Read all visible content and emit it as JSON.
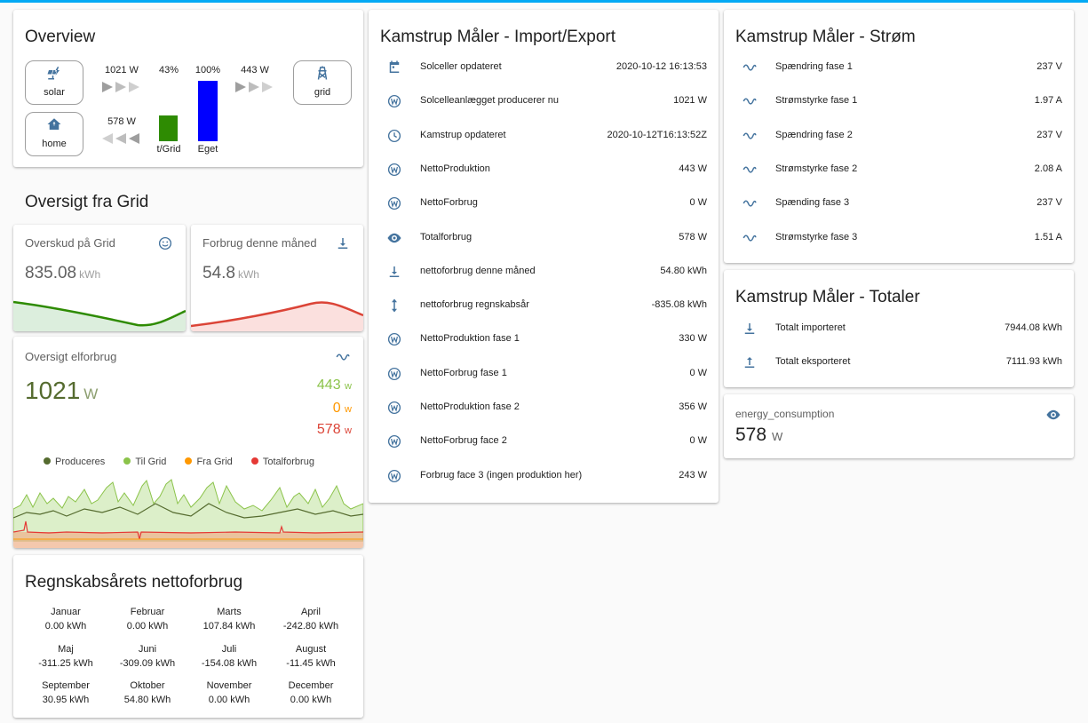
{
  "colors": {
    "accent": "#03a9f4",
    "icon": "#44739e",
    "green": "#2e8b02",
    "blue": "#0000ff",
    "red_line": "#db4437",
    "light_green": "#8bc34a",
    "orange": "#ff9800"
  },
  "overview": {
    "title": "Overview",
    "solar_label": "solar",
    "grid_label": "grid",
    "home_label": "home",
    "solar_to_home": "1021 W",
    "solar_pct": "43%",
    "self_pct": "100%",
    "grid_export": "443 W",
    "home_consumption": "578 W",
    "bar_grid_label": "t/Grid",
    "bar_self_label": "Eget"
  },
  "grid_section": {
    "title": "Oversigt fra Grid"
  },
  "surplus": {
    "name": "Overskud på Grid",
    "value": "835.08",
    "unit": "kWh",
    "icon": "smile-icon"
  },
  "month_use": {
    "name": "Forbrug denne måned",
    "value": "54.8",
    "unit": "kWh",
    "icon": "download-icon"
  },
  "elforbrug": {
    "name": "Oversigt elforbrug",
    "value": "1021",
    "unit": "W",
    "sub_values": [
      {
        "value": "443",
        "unit": "w",
        "color": "#8bc34a"
      },
      {
        "value": "0",
        "unit": "w",
        "color": "#ff9800"
      },
      {
        "value": "578",
        "unit": "w",
        "color": "#db4437"
      }
    ],
    "legend": [
      {
        "label": "Produceres",
        "color": "#556b2f"
      },
      {
        "label": "Til Grid",
        "color": "#8bc34a"
      },
      {
        "label": "Fra Grid",
        "color": "#ff9800"
      },
      {
        "label": "Totalforbrug",
        "color": "#e53935"
      }
    ]
  },
  "netto_year": {
    "title": "Regnskabsårets nettoforbrug",
    "months": [
      {
        "name": "Januar",
        "value": "0.00 kWh"
      },
      {
        "name": "Februar",
        "value": "0.00 kWh"
      },
      {
        "name": "Marts",
        "value": "107.84 kWh"
      },
      {
        "name": "April",
        "value": "-242.80 kWh"
      },
      {
        "name": "Maj",
        "value": "-311.25 kWh"
      },
      {
        "name": "Juni",
        "value": "-309.09 kWh"
      },
      {
        "name": "Juli",
        "value": "-154.08 kWh"
      },
      {
        "name": "August",
        "value": "-11.45 kWh"
      },
      {
        "name": "September",
        "value": "30.95 kWh"
      },
      {
        "name": "Oktober",
        "value": "54.80 kWh"
      },
      {
        "name": "November",
        "value": "0.00 kWh"
      },
      {
        "name": "December",
        "value": "0.00 kWh"
      }
    ]
  },
  "import_export": {
    "title": "Kamstrup Måler - Import/Export",
    "rows": [
      {
        "icon": "calendar-icon",
        "name": "Solceller opdateret",
        "value": "2020-10-12 16:13:53"
      },
      {
        "icon": "w-icon",
        "name": "Solcelleanlægget producerer nu",
        "value": "1021 W"
      },
      {
        "icon": "clock-icon",
        "name": "Kamstrup opdateret",
        "value": "2020-10-12T16:13:52Z"
      },
      {
        "icon": "w-icon",
        "name": "NettoProduktion",
        "value": "443 W"
      },
      {
        "icon": "w-icon",
        "name": "NettoForbrug",
        "value": "0 W"
      },
      {
        "icon": "eye-icon",
        "name": "Totalforbrug",
        "value": "578 W"
      },
      {
        "icon": "download-icon",
        "name": "nettoforbrug denne måned",
        "value": "54.80 kWh"
      },
      {
        "icon": "updown-icon",
        "name": "nettoforbrug regnskabsår",
        "value": "-835.08 kWh"
      },
      {
        "icon": "w-icon",
        "name": "NettoProduktion fase 1",
        "value": "330 W"
      },
      {
        "icon": "w-icon",
        "name": "NettoForbrug fase 1",
        "value": "0 W"
      },
      {
        "icon": "w-icon",
        "name": "NettoProduktion fase 2",
        "value": "356 W"
      },
      {
        "icon": "w-icon",
        "name": "NettoForbrug face 2",
        "value": "0 W"
      },
      {
        "icon": "w-icon",
        "name": "Forbrug face 3 (ingen produktion her)",
        "value": "243 W"
      }
    ]
  },
  "strom": {
    "title": "Kamstrup Måler - Strøm",
    "rows": [
      {
        "icon": "sine-icon",
        "name": "Spændring fase 1",
        "value": "237 V"
      },
      {
        "icon": "sine-icon",
        "name": "Strømstyrke fase 1",
        "value": "1.97 A"
      },
      {
        "icon": "sine-icon",
        "name": "Spændring fase 2",
        "value": "237 V"
      },
      {
        "icon": "sine-icon",
        "name": "Strømstyrke fase 2",
        "value": "2.08 A"
      },
      {
        "icon": "sine-icon",
        "name": "Spænding fase 3",
        "value": "237 V"
      },
      {
        "icon": "sine-icon",
        "name": "Strømstyrke fase 3",
        "value": "1.51 A"
      }
    ]
  },
  "totaler": {
    "title": "Kamstrup Måler - Totaler",
    "rows": [
      {
        "icon": "download-icon",
        "name": "Totalt importeret",
        "value": "7944.08 kWh"
      },
      {
        "icon": "upload-icon",
        "name": "Totalt eksporteret",
        "value": "7111.93 kWh"
      }
    ]
  },
  "energy": {
    "name": "energy_consumption",
    "value": "578",
    "unit": "W",
    "icon": "eye-icon"
  }
}
